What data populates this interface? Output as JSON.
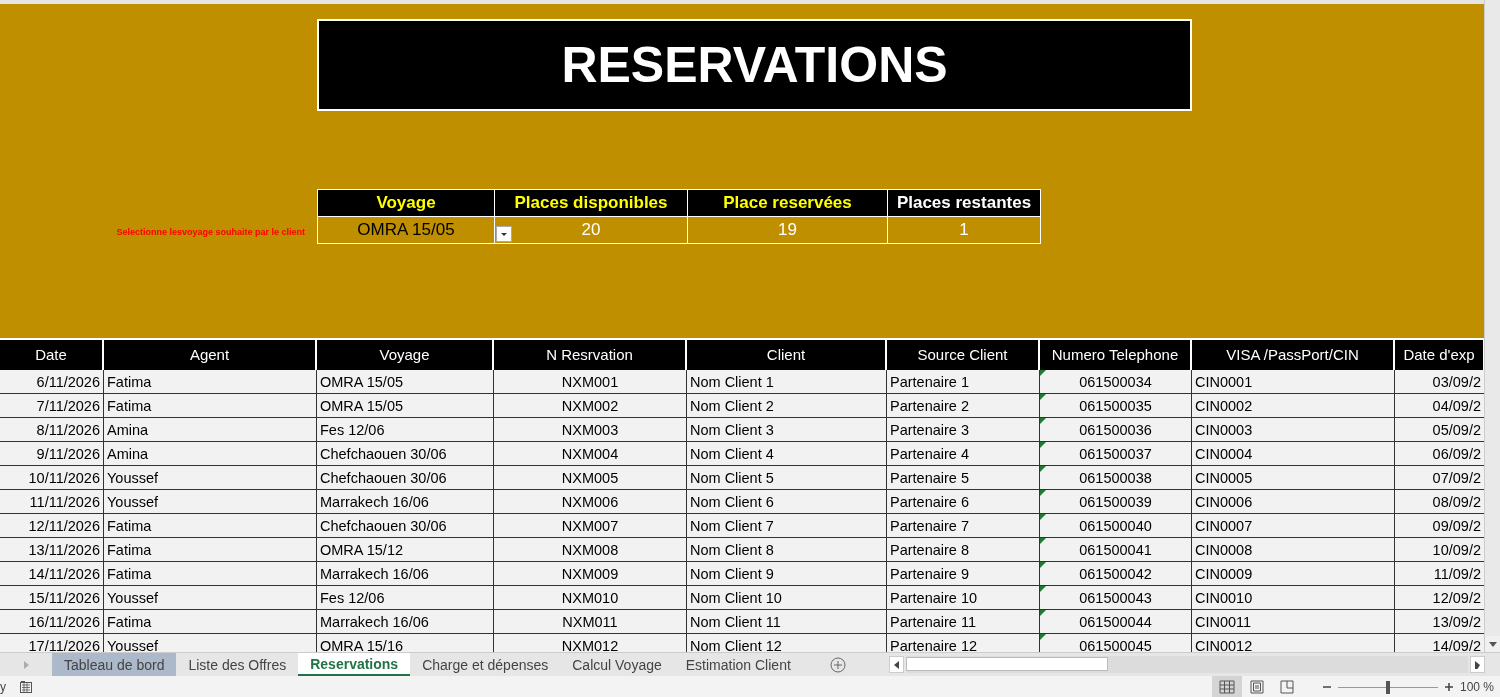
{
  "title": "RESERVATIONS",
  "summary": {
    "hint": "Selectionne lesvoyage souhaite par le client",
    "columns": [
      {
        "label": "Voyage",
        "highlighted": true
      },
      {
        "label": "Places disponibles",
        "highlighted": true
      },
      {
        "label": "Place reservées",
        "highlighted": true
      },
      {
        "label": "Places restantes",
        "highlighted": false
      }
    ],
    "values": [
      "OMRA 15/05",
      "20",
      "19",
      "1"
    ]
  },
  "table": {
    "columns": [
      "Date",
      "Agent",
      "Voyage",
      "N Resrvation",
      "Client",
      "Source Client",
      "Numero Telephone",
      "VISA /PassPort/CIN",
      "Date d'exp"
    ],
    "rows": [
      [
        "6/11/2026",
        "Fatima",
        "OMRA 15/05",
        "NXM001",
        "Nom Client 1",
        "Partenaire 1",
        "061500034",
        "CIN0001",
        "03/09/2"
      ],
      [
        "7/11/2026",
        "Fatima",
        "OMRA 15/05",
        "NXM002",
        "Nom Client 2",
        "Partenaire 2",
        "061500035",
        "CIN0002",
        "04/09/2"
      ],
      [
        "8/11/2026",
        "Amina",
        "Fes 12/06",
        "NXM003",
        "Nom Client 3",
        "Partenaire 3",
        "061500036",
        "CIN0003",
        "05/09/2"
      ],
      [
        "9/11/2026",
        "Amina",
        "Chefchaouen 30/06",
        "NXM004",
        "Nom Client 4",
        "Partenaire 4",
        "061500037",
        "CIN0004",
        "06/09/2"
      ],
      [
        "10/11/2026",
        "Youssef",
        "Chefchaouen 30/06",
        "NXM005",
        "Nom Client 5",
        "Partenaire 5",
        "061500038",
        "CIN0005",
        "07/09/2"
      ],
      [
        "11/11/2026",
        "Youssef",
        "Marrakech 16/06",
        "NXM006",
        "Nom Client 6",
        "Partenaire 6",
        "061500039",
        "CIN0006",
        "08/09/2"
      ],
      [
        "12/11/2026",
        "Fatima",
        "Chefchaouen 30/06",
        "NXM007",
        "Nom Client 7",
        "Partenaire 7",
        "061500040",
        "CIN0007",
        "09/09/2"
      ],
      [
        "13/11/2026",
        "Fatima",
        "OMRA 15/12",
        "NXM008",
        "Nom Client 8",
        "Partenaire 8",
        "061500041",
        "CIN0008",
        "10/09/2"
      ],
      [
        "14/11/2026",
        "Fatima",
        "Marrakech 16/06",
        "NXM009",
        "Nom Client 9",
        "Partenaire 9",
        "061500042",
        "CIN0009",
        "11/09/2"
      ],
      [
        "15/11/2026",
        "Youssef",
        "Fes 12/06",
        "NXM010",
        "Nom Client 10",
        "Partenaire 10",
        "061500043",
        "CIN0010",
        "12/09/2"
      ],
      [
        "16/11/2026",
        "Fatima",
        "Marrakech 16/06",
        "NXM011",
        "Nom Client 11",
        "Partenaire 11",
        "061500044",
        "CIN0011",
        "13/09/2"
      ],
      [
        "17/11/2026",
        "Youssef",
        "OMRA 15/16",
        "NXM012",
        "Nom Client 12",
        "Partenaire 12",
        "061500045",
        "CIN0012",
        "14/09/2"
      ]
    ]
  },
  "sheet_tabs": [
    {
      "label": "Tableau de bord",
      "selected": false,
      "color": "#acb9ca"
    },
    {
      "label": "Liste des Offres",
      "selected": false
    },
    {
      "label": "Reservations",
      "selected": true
    },
    {
      "label": "Charge et dépenses",
      "selected": false
    },
    {
      "label": "Calcul Voyage",
      "selected": false
    },
    {
      "label": "Estimation Client",
      "selected": false
    }
  ],
  "status_bar": {
    "status": "y",
    "zoom": {
      "level": 0.5,
      "reading": "100 %"
    }
  }
}
